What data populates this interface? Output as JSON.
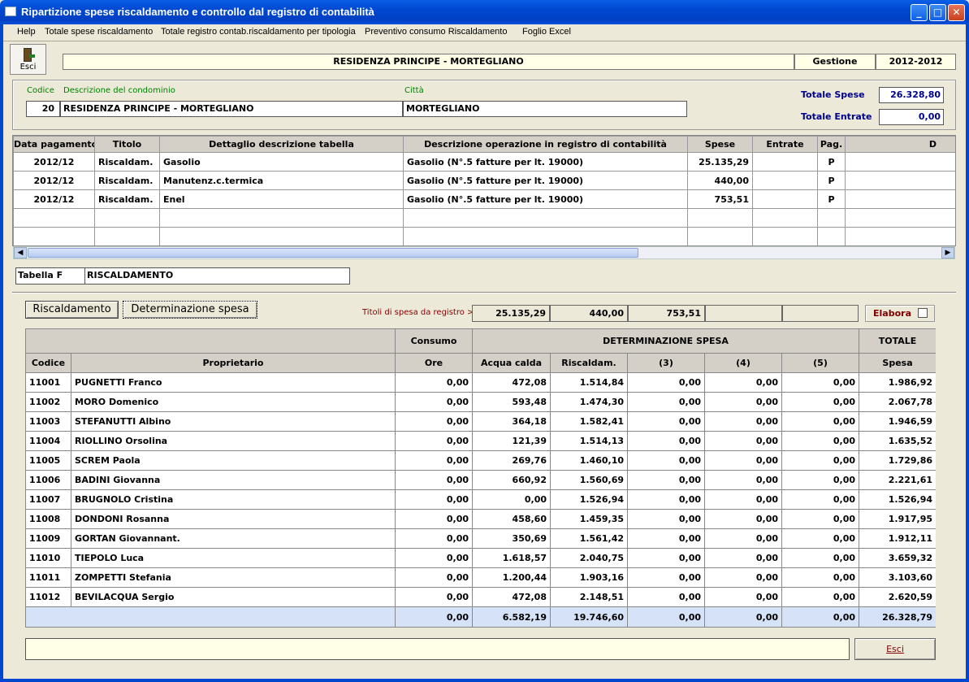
{
  "window": {
    "title": "Ripartizione spese riscaldamento e controllo dal registro di contabilità"
  },
  "menu": [
    "Help",
    "Totale spese riscaldamento",
    "Totale registro contab.riscaldamento per tipologia",
    "Preventivo consumo Riscaldamento",
    "Foglio Excel"
  ],
  "toolbar": {
    "esci_label": "Esci"
  },
  "header": {
    "name": "RESIDENZA PRINCIPE - MORTEGLIANO",
    "gestione_label": "Gestione",
    "gestione_value": "2012-2012"
  },
  "condo": {
    "codice_label": "Codice",
    "descr_label": "Descrizione del condominio",
    "citta_label": "Città",
    "codice": "20",
    "descr": "RESIDENZA PRINCIPE - MORTEGLIANO",
    "citta": "MORTEGLIANO",
    "tot_spese_label": "Totale Spese",
    "tot_spese": "26.328,80",
    "tot_entrate_label": "Totale Entrate",
    "tot_entrate": "0,00"
  },
  "registro": {
    "headers": [
      "Data pagamento",
      "Titolo",
      "Dettaglio descrizione tabella",
      "Descrizione operazione in registro di contabilità",
      "Spese",
      "Entrate",
      "Pag.",
      "D"
    ],
    "rows": [
      [
        "2012/12",
        "Riscaldam.",
        "Gasolio",
        "Gasolio (N°.5 fatture per lt. 19000)",
        "25.135,29",
        "",
        "P",
        ""
      ],
      [
        "2012/12",
        "Riscaldam.",
        "Manutenz.c.termica",
        "Gasolio (N°.5 fatture per lt. 19000)",
        "440,00",
        "",
        "P",
        ""
      ],
      [
        "2012/12",
        "Riscaldam.",
        "Enel",
        "Gasolio (N°.5 fatture per lt. 19000)",
        "753,51",
        "",
        "P",
        ""
      ],
      [
        "",
        "",
        "",
        "",
        "",
        "",
        "",
        ""
      ],
      [
        "",
        "",
        "",
        "",
        "",
        "",
        "",
        ""
      ]
    ]
  },
  "tabella": {
    "label": "Tabella F",
    "value": "RISCALDAMENTO"
  },
  "tabs": {
    "t1": "Riscaldamento",
    "t2": "Determinazione spesa"
  },
  "titoli": {
    "label": "Titoli di spesa da registro >",
    "values": [
      "25.135,29",
      "440,00",
      "753,51",
      "",
      ""
    ],
    "elabora_label": "Elabora"
  },
  "ripartizione": {
    "head1": {
      "consumo": "Consumo",
      "determ": "DETERMINAZIONE SPESA",
      "totale": "TOTALE"
    },
    "head2": [
      "Codice",
      "Proprietario",
      "Ore",
      "Acqua calda",
      "Riscaldam.",
      "(3)",
      "(4)",
      "(5)",
      "Spesa"
    ],
    "rows": [
      [
        "11001",
        "PUGNETTI Franco",
        "0,00",
        "472,08",
        "1.514,84",
        "0,00",
        "0,00",
        "0,00",
        "1.986,92"
      ],
      [
        "11002",
        "MORO Domenico",
        "0,00",
        "593,48",
        "1.474,30",
        "0,00",
        "0,00",
        "0,00",
        "2.067,78"
      ],
      [
        "11003",
        "STEFANUTTI Albino",
        "0,00",
        "364,18",
        "1.582,41",
        "0,00",
        "0,00",
        "0,00",
        "1.946,59"
      ],
      [
        "11004",
        "RIOLLINO Orsolina",
        "0,00",
        "121,39",
        "1.514,13",
        "0,00",
        "0,00",
        "0,00",
        "1.635,52"
      ],
      [
        "11005",
        "SCREM Paola",
        "0,00",
        "269,76",
        "1.460,10",
        "0,00",
        "0,00",
        "0,00",
        "1.729,86"
      ],
      [
        "11006",
        "BADINI Giovanna",
        "0,00",
        "660,92",
        "1.560,69",
        "0,00",
        "0,00",
        "0,00",
        "2.221,61"
      ],
      [
        "11007",
        "BRUGNOLO Cristina",
        "0,00",
        "0,00",
        "1.526,94",
        "0,00",
        "0,00",
        "0,00",
        "1.526,94"
      ],
      [
        "11008",
        "DONDONI Rosanna",
        "0,00",
        "458,60",
        "1.459,35",
        "0,00",
        "0,00",
        "0,00",
        "1.917,95"
      ],
      [
        "11009",
        "GORTAN Giovannant.",
        "0,00",
        "350,69",
        "1.561,42",
        "0,00",
        "0,00",
        "0,00",
        "1.912,11"
      ],
      [
        "11010",
        "TIEPOLO Luca",
        "0,00",
        "1.618,57",
        "2.040,75",
        "0,00",
        "0,00",
        "0,00",
        "3.659,32"
      ],
      [
        "11011",
        "ZOMPETTI Stefania",
        "0,00",
        "1.200,44",
        "1.903,16",
        "0,00",
        "0,00",
        "0,00",
        "3.103,60"
      ],
      [
        "11012",
        "BEVILACQUA Sergio",
        "0,00",
        "472,08",
        "2.148,51",
        "0,00",
        "0,00",
        "0,00",
        "2.620,59"
      ]
    ],
    "totals": [
      "0,00",
      "6.582,19",
      "19.746,60",
      "0,00",
      "0,00",
      "0,00",
      "26.328,79"
    ]
  },
  "footer": {
    "status": "",
    "esci_label": "Esci"
  }
}
